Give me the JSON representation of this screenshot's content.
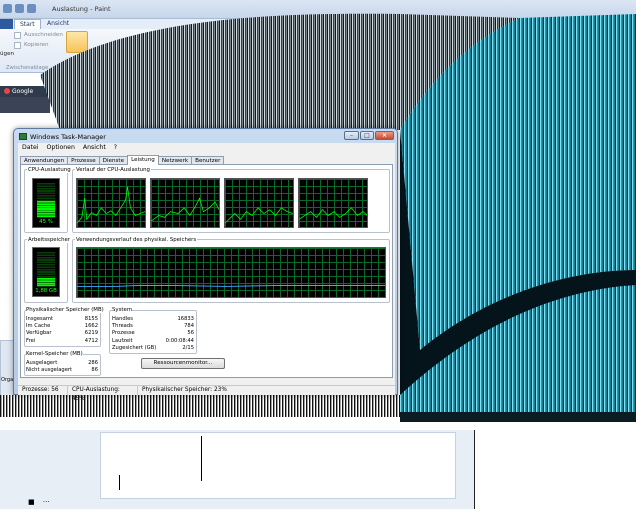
{
  "paint": {
    "title": "Auslastung - Paint",
    "tabs": [
      "Start",
      "Ansicht"
    ],
    "ribbon": {
      "cut": "Ausschneiden",
      "copy": "Kopieren",
      "paste_partial": "ügen",
      "clipboard_group": "Zwischenablage"
    }
  },
  "chrome": {
    "tab_label": "Google"
  },
  "explorer": {
    "org_label": "Orga",
    "fav_label": "Favo"
  },
  "taskmanager": {
    "title": "Windows Task-Manager",
    "menu": [
      "Datei",
      "Optionen",
      "Ansicht",
      "?"
    ],
    "tabs": [
      "Anwendungen",
      "Prozesse",
      "Dienste",
      "Leistung",
      "Netzwerk",
      "Benutzer"
    ],
    "active_tab": "Leistung",
    "cpu_usage_label": "CPU-Auslastung",
    "cpu_history_label": "Verlauf der CPU-Auslastung",
    "cpu_value": "45 %",
    "cpu_fraction": 0.45,
    "memory_label": "Arbeitsspeicher",
    "memory_history_label": "Verwendungsverlauf des physikal. Speichers",
    "memory_value": "1,88 GB",
    "memory_fraction": 0.23,
    "physical_memory": {
      "header": "Physikalischer Speicher (MB)",
      "rows": [
        {
          "label": "Insgesamt",
          "value": "8155"
        },
        {
          "label": "Im Cache",
          "value": "1662"
        },
        {
          "label": "Verfügbar",
          "value": "6219"
        },
        {
          "label": "Frei",
          "value": "4712"
        }
      ]
    },
    "kernel_memory": {
      "header": "Kernel-Speicher (MB)",
      "rows": [
        {
          "label": "Ausgelagert",
          "value": "286"
        },
        {
          "label": "Nicht ausgelagert",
          "value": "86"
        }
      ]
    },
    "system": {
      "header": "System",
      "rows": [
        {
          "label": "Handles",
          "value": "16833"
        },
        {
          "label": "Threads",
          "value": "784"
        },
        {
          "label": "Prozesse",
          "value": "56"
        },
        {
          "label": "Laufzeit",
          "value": "0:00:08:44"
        },
        {
          "label": "Zugesichert (GB)",
          "value": "2/15"
        }
      ]
    },
    "resource_monitor_button": "Ressourcenmonitor...",
    "status": {
      "processes": "Prozesse: 56",
      "cpu": "CPU-Auslastung: 45%",
      "memory": "Physikalischer Speicher: 23%"
    }
  }
}
